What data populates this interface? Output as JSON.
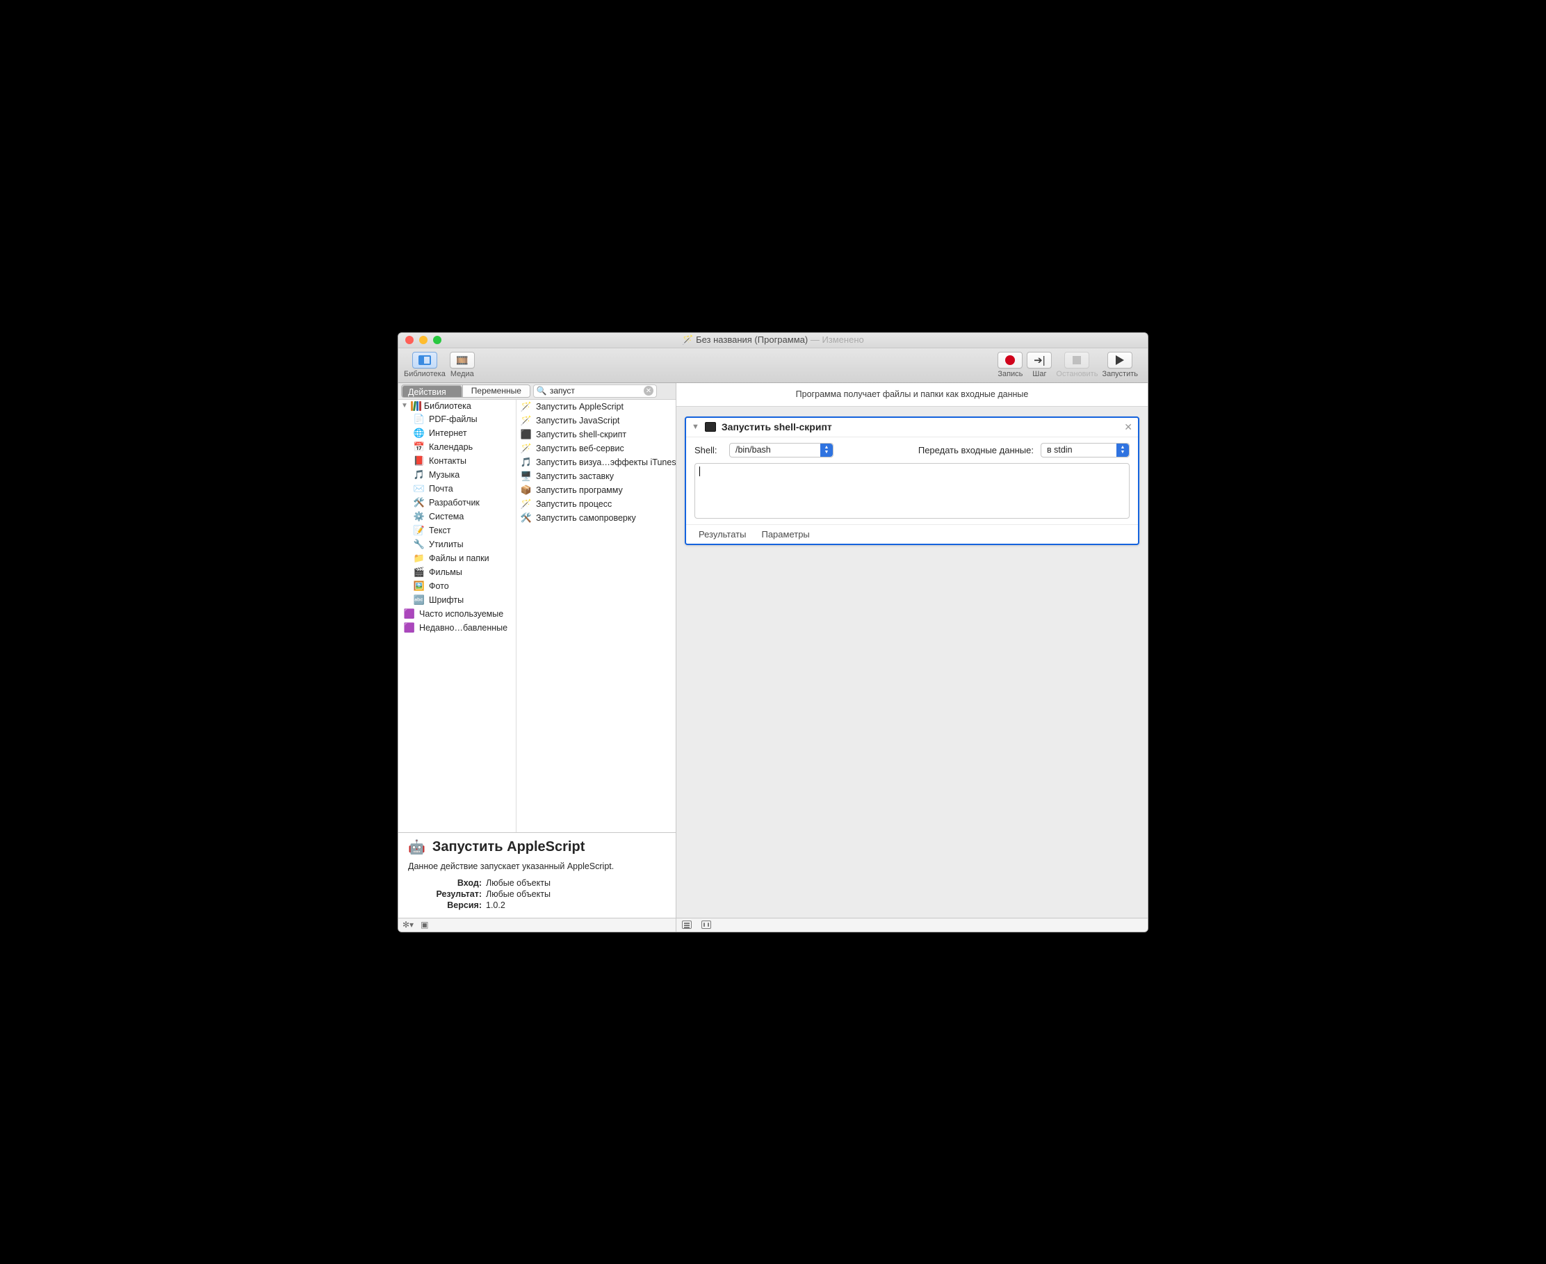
{
  "titlebar": {
    "app_icon": "🪄",
    "title_main": "Без названия (Программа)",
    "title_suffix": "— Изменено"
  },
  "toolbar": {
    "library": "Библиотека",
    "media": "Медиа",
    "record": "Запись",
    "step": "Шаг",
    "stop": "Остановить",
    "run": "Запустить"
  },
  "segbar": {
    "actions": "Действия",
    "variables": "Переменные",
    "search_value": "запуст"
  },
  "library_root": "Библиотека",
  "categories": [
    {
      "icon": "📄",
      "label": "PDF-файлы"
    },
    {
      "icon": "🌐",
      "label": "Интернет"
    },
    {
      "icon": "📅",
      "label": "Календарь"
    },
    {
      "icon": "📕",
      "label": "Контакты"
    },
    {
      "icon": "🎵",
      "label": "Музыка"
    },
    {
      "icon": "✉️",
      "label": "Почта"
    },
    {
      "icon": "🛠️",
      "label": "Разработчик"
    },
    {
      "icon": "⚙️",
      "label": "Система"
    },
    {
      "icon": "📝",
      "label": "Текст"
    },
    {
      "icon": "🔧",
      "label": "Утилиты"
    },
    {
      "icon": "📁",
      "label": "Файлы и папки"
    },
    {
      "icon": "🎬",
      "label": "Фильмы"
    },
    {
      "icon": "🖼️",
      "label": "Фото"
    },
    {
      "icon": "🔤",
      "label": "Шрифты"
    }
  ],
  "special_categories": [
    {
      "icon": "🟪",
      "label": "Часто используемые"
    },
    {
      "icon": "🟪",
      "label": "Недавно…бавленные"
    }
  ],
  "actions": [
    {
      "icon": "🪄",
      "label": "Запустить AppleScript"
    },
    {
      "icon": "🪄",
      "label": "Запустить JavaScript"
    },
    {
      "icon": "⬛",
      "label": "Запустить shell-скрипт"
    },
    {
      "icon": "🪄",
      "label": "Запустить веб-сервис"
    },
    {
      "icon": "🎵",
      "label": "Запустить визуа…эффекты iTunes"
    },
    {
      "icon": "🖥️",
      "label": "Запустить заставку"
    },
    {
      "icon": "📦",
      "label": "Запустить программу"
    },
    {
      "icon": "🪄",
      "label": "Запустить процесс"
    },
    {
      "icon": "🛠️",
      "label": "Запустить самопроверку"
    }
  ],
  "info": {
    "title": "Запустить AppleScript",
    "desc": "Данное действие запускает указанный AppleScript.",
    "input_label": "Вход:",
    "input_value": "Любые объекты",
    "result_label": "Результат:",
    "result_value": "Любые объекты",
    "version_label": "Версия:",
    "version_value": "1.0.2"
  },
  "flow": {
    "header": "Программа получает файлы и папки как входные данные",
    "step_title": "Запустить shell-скрипт",
    "shell_label": "Shell:",
    "shell_value": "/bin/bash",
    "input_mode_label": "Передать входные данные:",
    "input_mode_value": "в stdin",
    "results_tab": "Результаты",
    "params_tab": "Параметры"
  },
  "leftstatus": {
    "gear": "✻▾",
    "log": "▣"
  }
}
